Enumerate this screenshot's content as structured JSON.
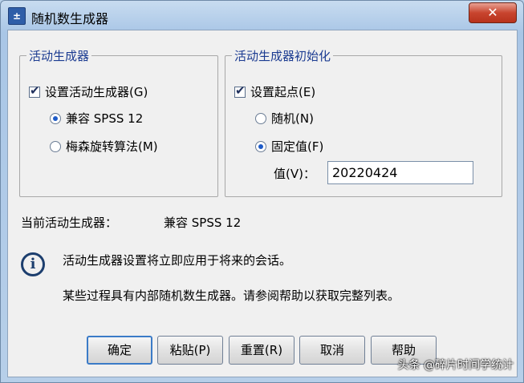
{
  "window": {
    "title": "随机数生成器",
    "close_label": "✕"
  },
  "active_generator_group": {
    "legend": "活动生成器",
    "set_active_label": "设置活动生成器(G)",
    "set_active_checked": true,
    "options": [
      {
        "label": "兼容 SPSS 12",
        "selected": true
      },
      {
        "label": "梅森旋转算法(M)",
        "selected": false
      }
    ]
  },
  "init_group": {
    "legend": "活动生成器初始化",
    "set_start_label": "设置起点(E)",
    "set_start_checked": true,
    "options": [
      {
        "label": "随机(N)",
        "selected": false
      },
      {
        "label": "固定值(F)",
        "selected": true
      }
    ],
    "value_label": "值(V)：",
    "value": "20220424"
  },
  "current": {
    "label": "当前活动生成器：",
    "value": "兼容 SPSS 12"
  },
  "info": {
    "line1": "活动生成器设置将立即应用于将来的会话。",
    "line2": "某些过程具有内部随机数生成器。请参阅帮助以获取完整列表。"
  },
  "buttons": {
    "ok": "确定",
    "paste": "粘贴(P)",
    "reset": "重置(R)",
    "cancel": "取消",
    "help": "帮助"
  },
  "watermark": "头条 @碎片时间学统计"
}
